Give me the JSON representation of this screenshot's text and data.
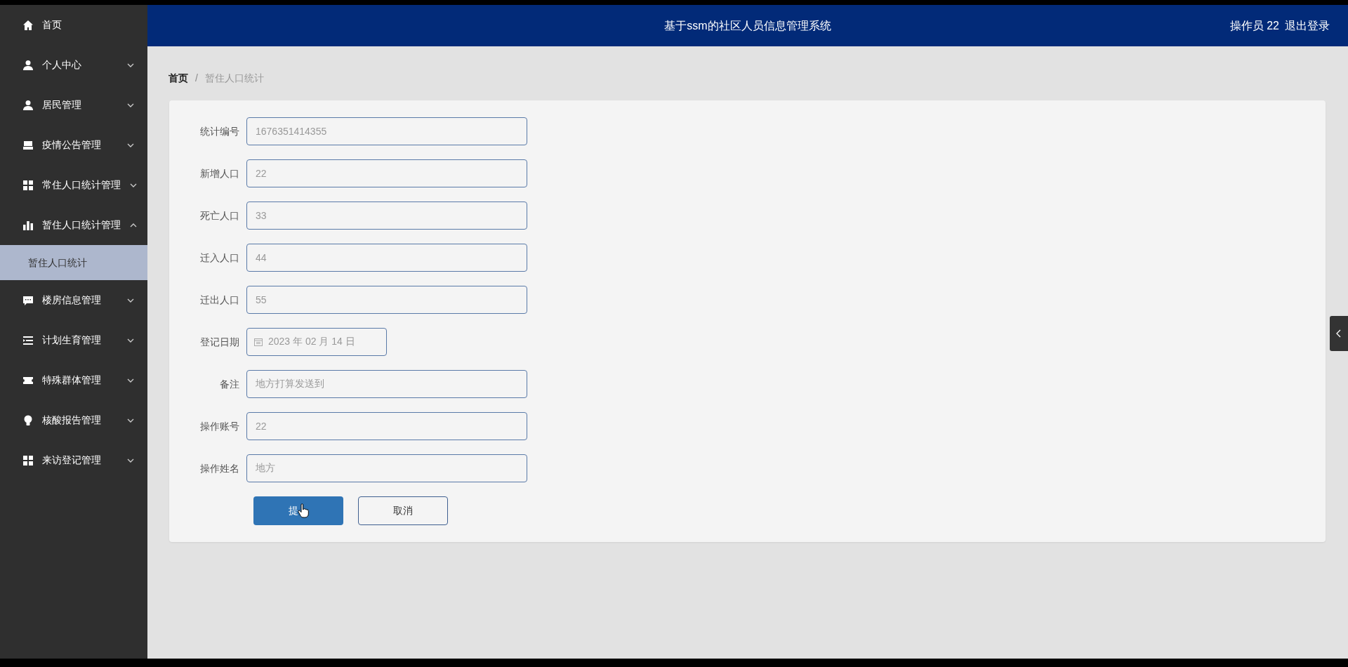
{
  "sidebar": {
    "items": [
      {
        "label": "首页",
        "kind": "link"
      },
      {
        "label": "个人中心",
        "kind": "menu",
        "expanded": false
      },
      {
        "label": "居民管理",
        "kind": "menu",
        "expanded": false
      },
      {
        "label": "疫情公告管理",
        "kind": "menu",
        "expanded": false
      },
      {
        "label": "常住人口统计管理",
        "kind": "menu",
        "expanded": false
      },
      {
        "label": "暂住人口统计管理",
        "kind": "menu",
        "expanded": true,
        "children": [
          {
            "label": "暂住人口统计",
            "selected": true
          }
        ]
      },
      {
        "label": "楼房信息管理",
        "kind": "menu",
        "expanded": false
      },
      {
        "label": "计划生育管理",
        "kind": "menu",
        "expanded": false
      },
      {
        "label": "特殊群体管理",
        "kind": "menu",
        "expanded": false
      },
      {
        "label": "核酸报告管理",
        "kind": "menu",
        "expanded": false
      },
      {
        "label": "来访登记管理",
        "kind": "menu",
        "expanded": false
      }
    ]
  },
  "header": {
    "title": "基于ssm的社区人员信息管理系统",
    "user": "操作员 22",
    "logout": "退出登录"
  },
  "breadcrumb": [
    {
      "label": "首页",
      "current": false
    },
    {
      "label": "暂住人口统计",
      "current": true
    }
  ],
  "breadcrumb_separator": "/",
  "form": {
    "fields": [
      {
        "label": "统计编号",
        "kind": "text",
        "value": "1676351414355"
      },
      {
        "label": "新增人口",
        "kind": "text",
        "value": "22"
      },
      {
        "label": "死亡人口",
        "kind": "text",
        "value": "33"
      },
      {
        "label": "迁入人口",
        "kind": "text",
        "value": "44"
      },
      {
        "label": "迁出人口",
        "kind": "text",
        "value": "55"
      },
      {
        "label": "登记日期",
        "kind": "date",
        "value": "2023 年 02 月 14 日"
      },
      {
        "label": "备注",
        "kind": "text",
        "value": "地方打算发送到"
      },
      {
        "label": "操作账号",
        "kind": "text",
        "value": "22"
      },
      {
        "label": "操作姓名",
        "kind": "text",
        "value": "地方"
      }
    ],
    "buttons": [
      {
        "label": "提",
        "kind": "primary"
      },
      {
        "label": "取消",
        "kind": "secondary"
      }
    ]
  }
}
